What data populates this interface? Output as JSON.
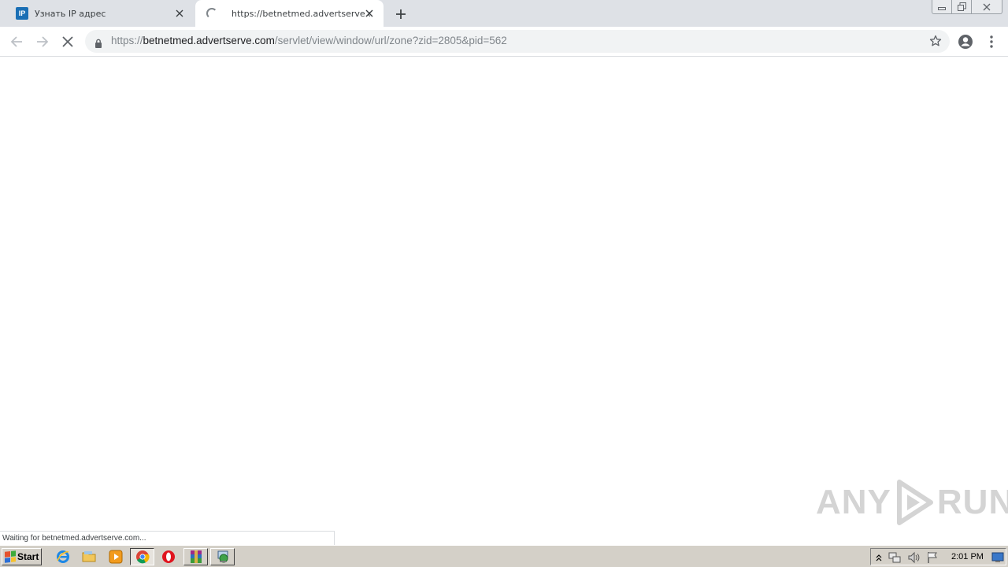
{
  "browser": {
    "tabs": [
      {
        "title": "Узнать IP адрес",
        "favicon": "IP",
        "active": false
      },
      {
        "title": "https://betnetmed.advertserve.com",
        "favicon": "loading-spinner",
        "active": true
      }
    ],
    "new_tab_icon": "plus-icon",
    "window_controls": [
      "minimize-icon",
      "restore-icon",
      "close-icon"
    ]
  },
  "toolbar": {
    "back_icon": "arrow-left-icon",
    "forward_icon": "arrow-right-icon",
    "stop_icon": "stop-x-icon",
    "url_scheme": "https://",
    "url_host": "betnetmed.advertserve.com",
    "url_path": "/servlet/view/window/url/zone?zid=2805&pid=562",
    "bookmark_icon": "star-icon",
    "profile_icon": "account-icon",
    "menu_icon": "kebab-menu-icon"
  },
  "status_bar": {
    "text": "Waiting for betnetmed.advertserve.com..."
  },
  "watermark": {
    "left": "ANY",
    "right": "RUN"
  },
  "taskbar": {
    "start_label": "Start",
    "quick_launch": [
      "internet-explorer-icon",
      "folder-icon",
      "media-player-icon",
      "chrome-icon",
      "opera-icon",
      "winrar-icon",
      "network-globe-icon"
    ],
    "tray_icons": [
      "show-hidden-icon",
      "network-icon",
      "volume-icon",
      "flag-icon"
    ],
    "clock": "2:01 PM"
  },
  "colors": {
    "tabstrip": "#dee1e6",
    "omnibox": "#f1f3f4",
    "taskbar": "#d4d0c8",
    "ip_favicon": "#1a6fb5"
  }
}
